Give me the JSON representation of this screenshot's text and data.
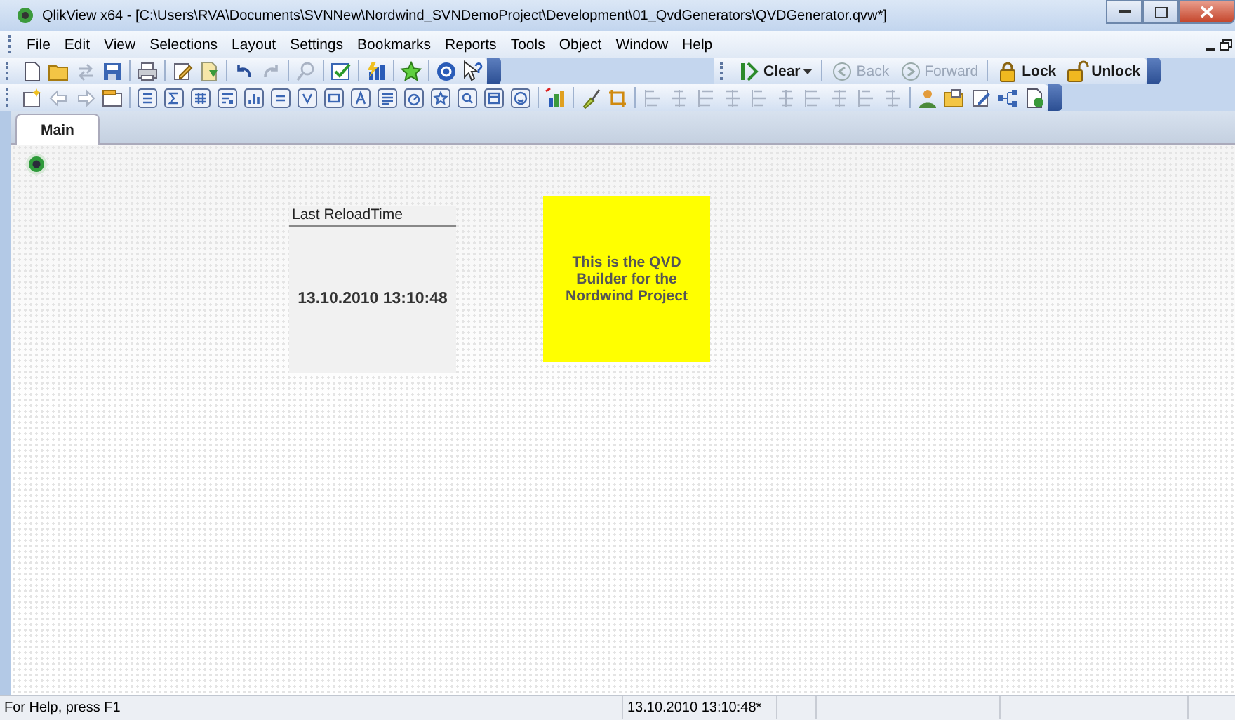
{
  "window": {
    "title": "QlikView x64 - [C:\\Users\\RVA\\Documents\\SVNNew\\Nordwind_SVNDemoProject\\Development\\01_QvdGenerators\\QVDGenerator.qvw*]"
  },
  "menu": [
    {
      "label": "File"
    },
    {
      "label": "Edit"
    },
    {
      "label": "View"
    },
    {
      "label": "Selections"
    },
    {
      "label": "Layout"
    },
    {
      "label": "Settings"
    },
    {
      "label": "Bookmarks"
    },
    {
      "label": "Reports"
    },
    {
      "label": "Tools"
    },
    {
      "label": "Object"
    },
    {
      "label": "Window"
    },
    {
      "label": "Help"
    }
  ],
  "selection_toolbar": [
    {
      "kind": "clear",
      "label": "Clear",
      "disabled": false
    },
    {
      "kind": "back",
      "label": "Back",
      "disabled": true
    },
    {
      "kind": "forward",
      "label": "Forward",
      "disabled": true
    },
    {
      "kind": "lock",
      "label": "Lock",
      "disabled": false
    },
    {
      "kind": "unlock",
      "label": "Unlock",
      "disabled": false
    }
  ],
  "tabs": [
    {
      "label": "Main",
      "selected": true
    }
  ],
  "sheet_objects": [
    {
      "kind": "input",
      "caption": "Last ReloadTime",
      "value": "13.10.2010 13:10:48"
    },
    {
      "kind": "text",
      "text": "This is the QVD Builder for the Nordwind Project"
    }
  ],
  "status_bar": {
    "help": "For Help, press F1",
    "reload_time": "13.10.2010 13:10:48*"
  }
}
